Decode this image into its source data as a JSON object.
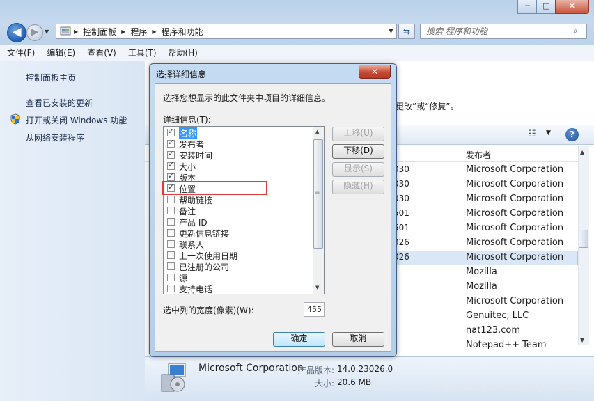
{
  "window": {
    "minimize_label": "─",
    "maximize_label": "□",
    "close_label": "✕"
  },
  "nav": {
    "back_glyph": "◀",
    "forward_glyph": "▶",
    "dropdown_glyph": "▼",
    "refresh_glyph": "⇆",
    "breadcrumbs": [
      "控制面板",
      "程序",
      "程序和功能"
    ],
    "search_placeholder": "搜索 程序和功能",
    "search_glyph": "⌕"
  },
  "menu": [
    "文件(F)",
    "编辑(E)",
    "查看(V)",
    "工具(T)",
    "帮助(H)"
  ],
  "sidebar": {
    "items": [
      {
        "label": "控制面板主页"
      },
      {
        "label": "查看已安装的更新"
      },
      {
        "label": "打开或关闭 Windows 功能"
      },
      {
        "label": "从网络安装程序"
      }
    ]
  },
  "content": {
    "description_fragment": "更改”或“修复”。",
    "columns": {
      "publisher": "发布者"
    },
    "rows": [
      {
        "ver": "030",
        "pub": "Microsoft Corporation"
      },
      {
        "ver": "030",
        "pub": "Microsoft Corporation"
      },
      {
        "ver": "030",
        "pub": "Microsoft Corporation"
      },
      {
        "ver": "501",
        "pub": "Microsoft Corporation"
      },
      {
        "ver": "501",
        "pub": "Microsoft Corporation"
      },
      {
        "ver": "026",
        "pub": "Microsoft Corporation"
      },
      {
        "ver": "026",
        "pub": "Microsoft Corporation"
      },
      {
        "ver": "",
        "pub": "Mozilla"
      },
      {
        "ver": "",
        "pub": "Mozilla"
      },
      {
        "ver": "",
        "pub": "Microsoft Corporation"
      },
      {
        "ver": "",
        "pub": "Genuitec, LLC"
      },
      {
        "ver": "",
        "pub": "nat123.com"
      },
      {
        "ver": "",
        "pub": "Notepad++ Team"
      }
    ],
    "help_glyph": "?",
    "view_glyph": "☷"
  },
  "details": {
    "name": "Microsoft Corporation",
    "version_label": "产品版本:",
    "version": "14.0.23026.0",
    "size_label": "大小:",
    "size": "20.6 MB"
  },
  "watermark": "https://blog.csdn.net/qq_38161040",
  "dialog": {
    "title": "选择详细信息",
    "close_glyph": "✕",
    "instruction": "选择您想显示的此文件夹中项目的详细信息。",
    "list_label": "详细信息(T):",
    "items": [
      {
        "label": "名称",
        "checked": true
      },
      {
        "label": "发布者",
        "checked": true
      },
      {
        "label": "安装时间",
        "checked": true
      },
      {
        "label": "大小",
        "checked": true
      },
      {
        "label": "版本",
        "checked": true
      },
      {
        "label": "位置",
        "checked": true
      },
      {
        "label": "帮助链接",
        "checked": false
      },
      {
        "label": "备注",
        "checked": false
      },
      {
        "label": "产品 ID",
        "checked": false
      },
      {
        "label": "更新信息链接",
        "checked": false
      },
      {
        "label": "联系人",
        "checked": false
      },
      {
        "label": "上一次使用日期",
        "checked": false
      },
      {
        "label": "已注册的公司",
        "checked": false
      },
      {
        "label": "源",
        "checked": false
      },
      {
        "label": "支持电话",
        "checked": false
      }
    ],
    "buttons": {
      "move_up": "上移(U)",
      "move_down": "下移(D)",
      "show": "显示(S)",
      "hide": "隐藏(H)",
      "ok": "确定",
      "cancel": "取消"
    },
    "width_label": "选中列的宽度(像素)(W):",
    "width_value": "455"
  }
}
